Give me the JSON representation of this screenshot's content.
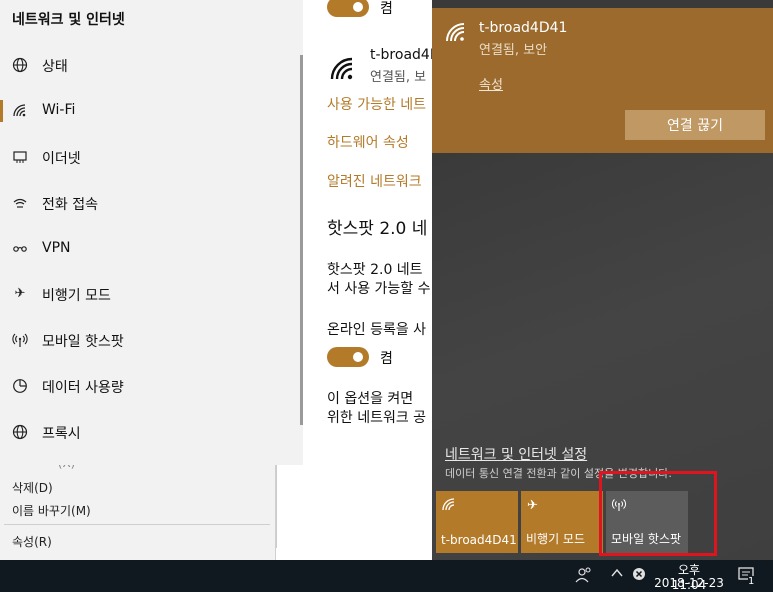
{
  "context_menu": {
    "items": [
      {
        "label": "삭제(D)"
      },
      {
        "label": "이름 바꾸기(M)"
      },
      {
        "label": "속성(R)"
      }
    ]
  },
  "settings": {
    "title": "네트워크 및 인터넷",
    "nav": [
      {
        "label": "상태",
        "icon": "globe-icon"
      },
      {
        "label": "Wi-Fi",
        "icon": "wifi-icon",
        "active": true
      },
      {
        "label": "이더넷",
        "icon": "ethernet-icon"
      },
      {
        "label": "전화 접속",
        "icon": "dialup-icon"
      },
      {
        "label": "VPN",
        "icon": "vpn-icon"
      },
      {
        "label": "비행기 모드",
        "icon": "airplane-icon"
      },
      {
        "label": "모바일 핫스팟",
        "icon": "hotspot-icon"
      },
      {
        "label": "데이터 사용량",
        "icon": "data-usage-icon"
      },
      {
        "label": "프록시",
        "icon": "proxy-globe-icon"
      }
    ],
    "content": {
      "toggle1_label": "켬",
      "network_name": "t-broad4D",
      "network_status": "연결됨, 보",
      "link_available": "사용 가능한 네트",
      "link_hardware": "하드웨어 속성",
      "link_known": "알려진 네트워크",
      "hotspot_heading": "핫스팟 2.0 네",
      "hotspot_desc_1": "핫스팟 2.0 네트",
      "hotspot_desc_2": "서 사용 가능할 수",
      "online_reg": "온라인 등록을 사",
      "toggle2_label": "켬",
      "option_desc_1": "이 옵션을 켜면",
      "option_desc_2": "위한 네트워크 공"
    }
  },
  "flyout": {
    "connection_name": "t-broad4D41",
    "connection_status": "연결됨, 보안",
    "properties_link": "속성",
    "disconnect_button": "연결 끊기",
    "settings_link": "네트워크 및 인터넷 설정",
    "settings_sub": "데이터 통신 연결 전환과 같이 설정을 변경합니다.",
    "tiles": [
      {
        "label": "t-broad4D41",
        "icon": "wifi-icon",
        "active": true
      },
      {
        "label": "비행기 모드",
        "icon": "airplane-icon",
        "active": true
      },
      {
        "label": "모바일 핫스팟",
        "icon": "hotspot-icon",
        "active": false
      }
    ],
    "accent_color": "#b37a29"
  },
  "taskbar": {
    "time": "오후 11:04",
    "date": "2018-12-23",
    "notification_count": "1"
  }
}
